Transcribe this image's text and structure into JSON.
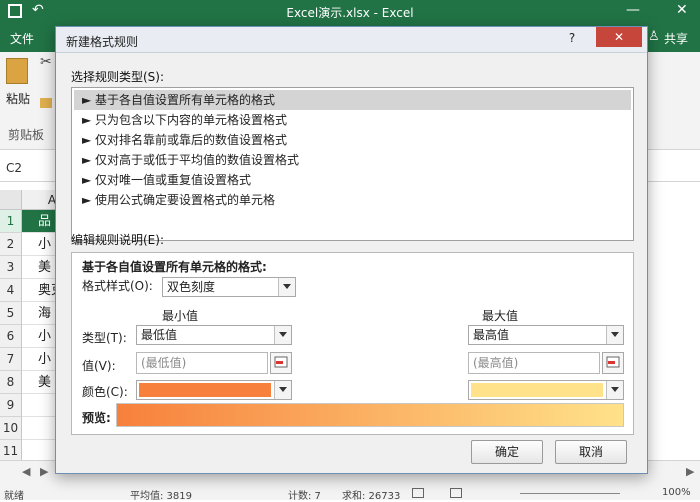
{
  "window": {
    "title": "Excel演示.xlsx - Excel"
  },
  "ribbon": {
    "file_tab": "文件",
    "share": "共享",
    "paste_label": "粘贴",
    "clipboard_label": "剪贴板"
  },
  "formula_bar": {
    "name_box": "C2"
  },
  "grid": {
    "col_a_header": "A",
    "rows": [
      {
        "num": "1",
        "a": "品"
      },
      {
        "num": "2",
        "a": "小"
      },
      {
        "num": "3",
        "a": "美"
      },
      {
        "num": "4",
        "a": "奥克"
      },
      {
        "num": "5",
        "a": "海"
      },
      {
        "num": "6",
        "a": "小"
      },
      {
        "num": "7",
        "a": "小"
      },
      {
        "num": "8",
        "a": "美"
      },
      {
        "num": "9",
        "a": ""
      },
      {
        "num": "10",
        "a": ""
      },
      {
        "num": "11",
        "a": ""
      }
    ]
  },
  "status": {
    "ready": "就绪",
    "average": "平均值: 3819",
    "count": "计数: 7",
    "sum": "求和: 26733",
    "zoom": "100%"
  },
  "dialog": {
    "title": "新建格式规则",
    "help": "?",
    "select_type_label": "选择规则类型(S):",
    "rule_types": [
      "► 基于各自值设置所有单元格的格式",
      "► 只为包含以下内容的单元格设置格式",
      "► 仅对排名靠前或靠后的数值设置格式",
      "► 仅对高于或低于平均值的数值设置格式",
      "► 仅对唯一值或重复值设置格式",
      "► 使用公式确定要设置格式的单元格"
    ],
    "edit_desc_label": "编辑规则说明(E):",
    "edit_heading": "基于各自值设置所有单元格的格式:",
    "format_style_label": "格式样式(O):",
    "format_style_value": "双色刻度",
    "min_header": "最小值",
    "max_header": "最大值",
    "type_label": "类型(T):",
    "min_type": "最低值",
    "max_type": "最高值",
    "value_label": "值(V):",
    "min_value_placeholder": "(最低值)",
    "max_value_placeholder": "(最高值)",
    "color_label": "颜色(C):",
    "min_color": "#f7803c",
    "max_color": "#ffe28a",
    "preview_label": "预览:",
    "ok": "确定",
    "cancel": "取消"
  }
}
